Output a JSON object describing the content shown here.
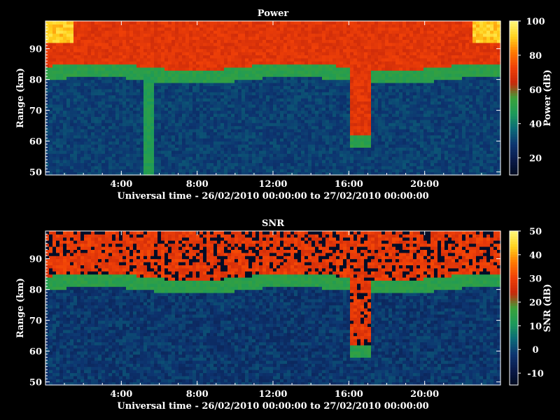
{
  "chart_data": [
    {
      "type": "heatmap",
      "title": "Power",
      "xlabel": "Universal time - 26/02/2010 00:00:00 to 27/02/2010 00:00:00",
      "ylabel": "Range (km)",
      "colorbar_label": "Power (dB)",
      "xlim": [
        0,
        24
      ],
      "ylim": [
        49,
        99
      ],
      "x_ticks": [
        "4:00",
        "8:00",
        "12:00",
        "16:00",
        "20:00"
      ],
      "y_ticks": [
        50,
        60,
        70,
        80,
        90
      ],
      "colorbar_range": [
        10,
        100
      ],
      "colorbar_ticks": [
        20,
        40,
        60,
        80,
        100
      ],
      "colormap": [
        "#000a1e",
        "#0a1a4a",
        "#0d3470",
        "#0b6a78",
        "#1c9a5a",
        "#3aa23a",
        "#c8280a",
        "#f04008",
        "#ff7a00",
        "#ffd21e",
        "#fff87a"
      ],
      "description_values": {
        "upper_layer_range_km": [
          82,
          99
        ],
        "upper_layer_power_db": 62,
        "lower_region_power_db": 22
      }
    },
    {
      "type": "heatmap",
      "title": "SNR",
      "xlabel": "Universal time - 26/02/2010 00:00:00 to 27/02/2010 00:00:00",
      "ylabel": "Range (km)",
      "colorbar_label": "SNR (dB)",
      "xlim": [
        0,
        24
      ],
      "ylim": [
        49,
        99
      ],
      "x_ticks": [
        "4:00",
        "8:00",
        "12:00",
        "16:00",
        "20:00"
      ],
      "y_ticks": [
        50,
        60,
        70,
        80,
        90
      ],
      "colorbar_range": [
        -15,
        50
      ],
      "colorbar_ticks": [
        -10,
        0,
        10,
        20,
        30,
        40,
        50
      ],
      "colormap": [
        "#000a1e",
        "#0a1a4a",
        "#0d3470",
        "#0b6a78",
        "#1c9a5a",
        "#3aa23a",
        "#c8280a",
        "#f04008",
        "#ff7a00",
        "#ffd21e",
        "#fff87a"
      ]
    }
  ]
}
